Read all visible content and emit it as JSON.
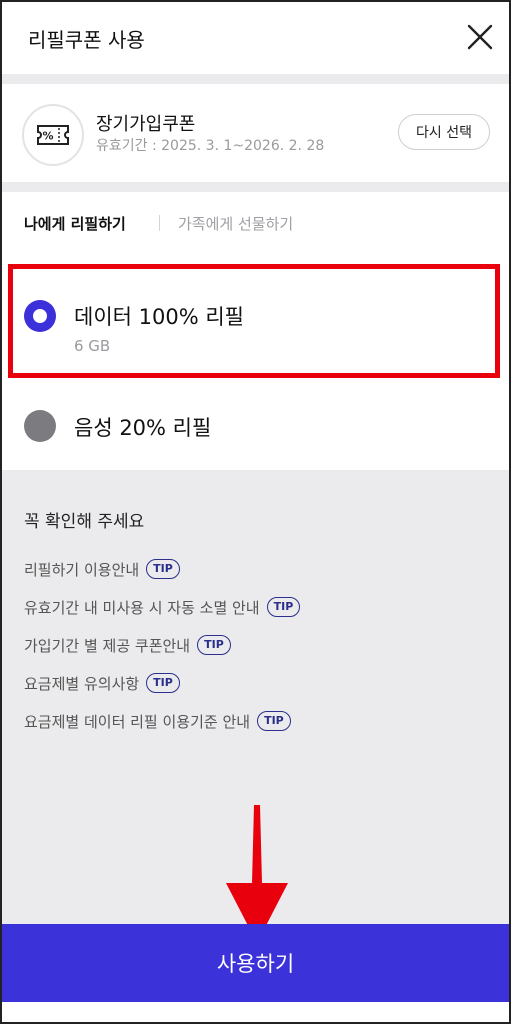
{
  "header": {
    "title": "리필쿠폰 사용",
    "close_icon": "close-icon"
  },
  "coupon": {
    "icon": "coupon-ticket-icon",
    "icon_text": "%",
    "name": "장기가입쿠폰",
    "period": "유효기간 : 2025. 3. 1~2026. 2. 28",
    "reselect_label": "다시 선택"
  },
  "tabs": [
    {
      "label": "나에게 리필하기",
      "active": true
    },
    {
      "label": "가족에게 선물하기",
      "active": false
    }
  ],
  "options": [
    {
      "title": "데이터 100% 리필",
      "subtitle": "6 GB",
      "selected": true
    },
    {
      "title": "음성 20% 리필",
      "selected": false
    }
  ],
  "notice": {
    "title": "꼭 확인해 주세요",
    "tip_label": "TIP",
    "items": [
      {
        "text": "리필하기 이용안내"
      },
      {
        "text": "유효기간 내 미사용 시 자동 소멸 안내"
      },
      {
        "text": "가입기간 별 제공 쿠폰안내"
      },
      {
        "text": "요금제별 유의사항"
      },
      {
        "text": "요금제별 데이터 리필 이용기준 안내"
      }
    ]
  },
  "use_button": {
    "label": "사용하기"
  },
  "colors": {
    "accent": "#3c32da",
    "highlight": "#e8000d",
    "background": "#ebebed"
  }
}
